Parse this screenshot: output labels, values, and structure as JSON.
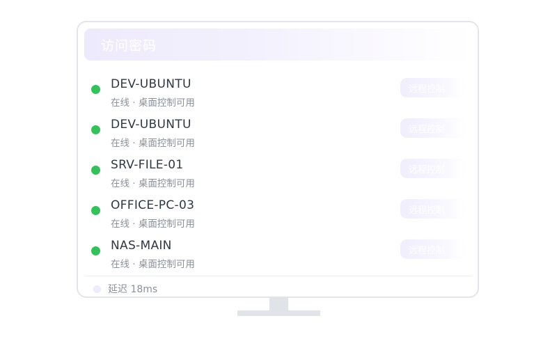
{
  "header": {
    "title": "访问密码"
  },
  "devices": [
    {
      "name": "DEV-UBUNTU",
      "status": "在线 · 桌面控制可用",
      "action_label": "远程控制"
    },
    {
      "name": "DEV-UBUNTU",
      "status": "在线 · 桌面控制可用",
      "action_label": "远程控制"
    },
    {
      "name": "SRV-FILE-01",
      "status": "在线 · 桌面控制可用",
      "action_label": "远程控制"
    },
    {
      "name": "OFFICE-PC-03",
      "status": "在线 · 桌面控制可用",
      "action_label": "远程控制"
    },
    {
      "name": "NAS-MAIN",
      "status": "在线 · 桌面控制可用",
      "action_label": "远程控制"
    }
  ],
  "footer": {
    "latency": "延迟 18ms"
  },
  "colors": {
    "online": "#33c25a",
    "accent": "#eeeafd",
    "text_primary": "#2f3742",
    "text_secondary": "#8a919c",
    "frame": "#e3e5ea"
  }
}
